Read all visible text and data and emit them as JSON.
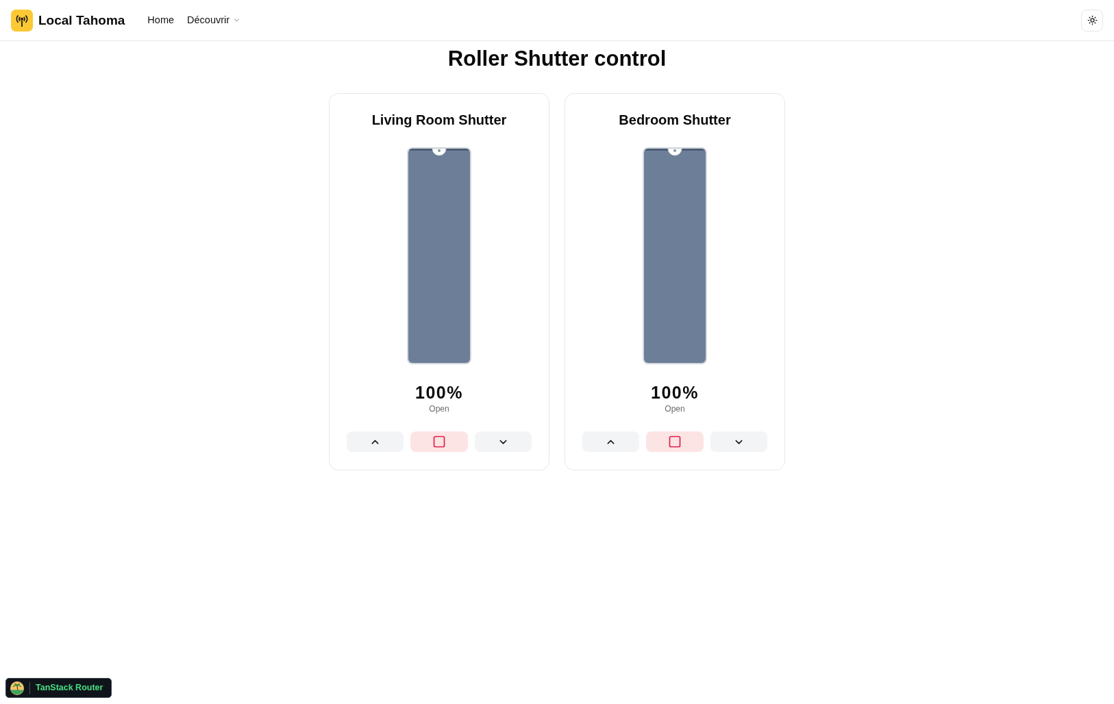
{
  "header": {
    "app_name": "Local Tahoma",
    "nav": [
      {
        "label": "Home",
        "kind": "link"
      },
      {
        "label": "Découvrir",
        "kind": "dropdown"
      }
    ]
  },
  "page_title": "Roller Shutter control",
  "shutters": [
    {
      "name": "Living Room Shutter",
      "level": 1,
      "percent": "100%",
      "status": "Open",
      "controls": [
        {
          "kind": "up"
        },
        {
          "kind": "stop"
        },
        {
          "kind": "down"
        }
      ]
    },
    {
      "name": "Bedroom Shutter",
      "level": 1,
      "percent": "100%",
      "status": "Open",
      "controls": [
        {
          "kind": "up"
        },
        {
          "kind": "stop"
        },
        {
          "kind": "down"
        }
      ]
    }
  ],
  "devtools_badge": {
    "label": "TanStack Router"
  }
}
